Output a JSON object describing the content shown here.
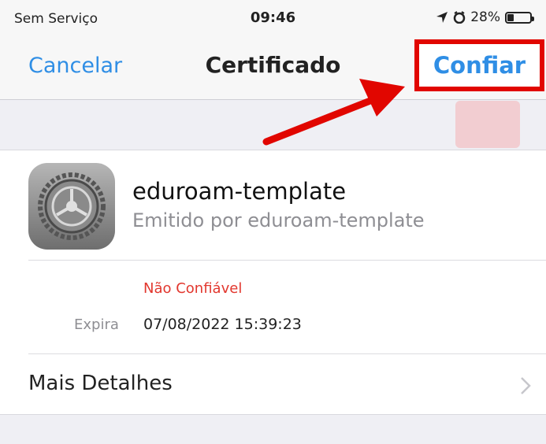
{
  "status_bar": {
    "carrier": "Sem Serviço",
    "time": "09:46",
    "battery": "28%",
    "battery_level": 0.28
  },
  "nav": {
    "cancel_label": "Cancelar",
    "title": "Certificado",
    "trust_label": "Confiar"
  },
  "certificate": {
    "name": "eduroam-template",
    "issuer": "Emitido por eduroam-template",
    "trust_status": "Não Confiável",
    "expires_label": "Expira",
    "expires_value": "07/08/2022 15:39:23"
  },
  "details": {
    "label": "Mais Detalhes"
  },
  "colors": {
    "accent": "#2f8ee5",
    "highlight": "#e10600",
    "untrusted": "#e2372e"
  }
}
